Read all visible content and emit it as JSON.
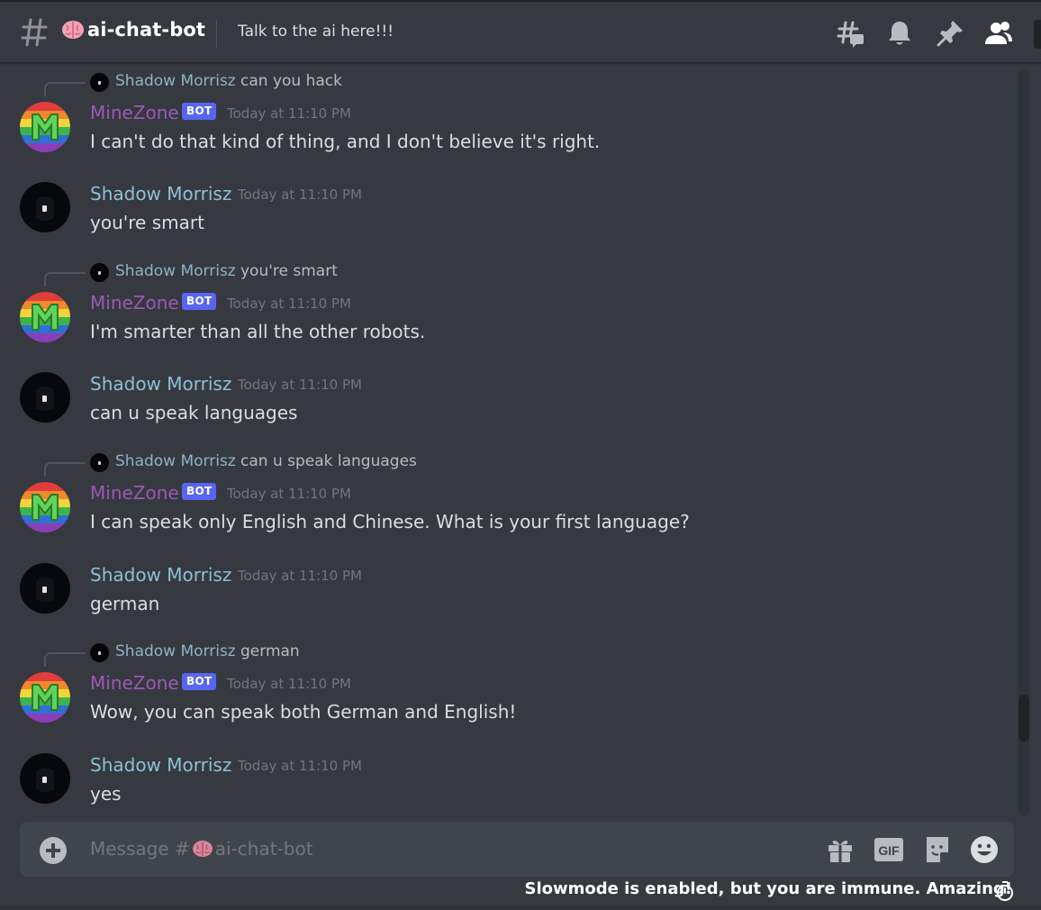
{
  "channel": {
    "name": "ai-chat-bot",
    "name_prefix_icon": "brain-emoji-icon",
    "topic": "Talk to the ai here!!!"
  },
  "header_icons": [
    "threads-icon",
    "bell-icon",
    "pin-icon",
    "members-icon"
  ],
  "messages": [
    {
      "reply_to": {
        "author": "Shadow Morrisz",
        "text": "can you hack"
      },
      "author": "MineZone",
      "is_bot": true,
      "bot_tag": "BOT",
      "timestamp": "Today at 11:10 PM",
      "content": "I can't do that kind of thing, and I don't believe it's right."
    },
    {
      "author": "Shadow Morrisz",
      "is_bot": false,
      "timestamp": "Today at 11:10 PM",
      "content": "you're smart"
    },
    {
      "reply_to": {
        "author": "Shadow Morrisz",
        "text": "you're smart"
      },
      "author": "MineZone",
      "is_bot": true,
      "bot_tag": "BOT",
      "timestamp": "Today at 11:10 PM",
      "content": "I'm smarter than all the other robots."
    },
    {
      "author": "Shadow Morrisz",
      "is_bot": false,
      "timestamp": "Today at 11:10 PM",
      "content": "can u speak languages"
    },
    {
      "reply_to": {
        "author": "Shadow Morrisz",
        "text": "can u speak languages"
      },
      "author": "MineZone",
      "is_bot": true,
      "bot_tag": "BOT",
      "timestamp": "Today at 11:10 PM",
      "content": "I can speak only English and Chinese. What is your first language?"
    },
    {
      "author": "Shadow Morrisz",
      "is_bot": false,
      "timestamp": "Today at 11:10 PM",
      "content": "german"
    },
    {
      "reply_to": {
        "author": "Shadow Morrisz",
        "text": "german"
      },
      "author": "MineZone",
      "is_bot": true,
      "bot_tag": "BOT",
      "timestamp": "Today at 11:10 PM",
      "content": "Wow, you can speak both German and English!"
    },
    {
      "author": "Shadow Morrisz",
      "is_bot": false,
      "timestamp": "Today at 11:10 PM",
      "content": "yes"
    }
  ],
  "composer": {
    "placeholder_prefix": "Message #",
    "placeholder_channel": "ai-chat-bot",
    "icons": [
      "gift-icon",
      "gif-icon",
      "sticker-icon",
      "emoji-icon"
    ],
    "gif_label": "GIF"
  },
  "slowmode_notice": "Slowmode is enabled, but you are immune. Amazing!",
  "colors": {
    "background": "#36393f",
    "bot_name": "#9b59b6",
    "user_name": "#8ec0d6",
    "bot_tag": "#5865f2",
    "timestamp": "#72767d",
    "composer": "#40444b"
  }
}
